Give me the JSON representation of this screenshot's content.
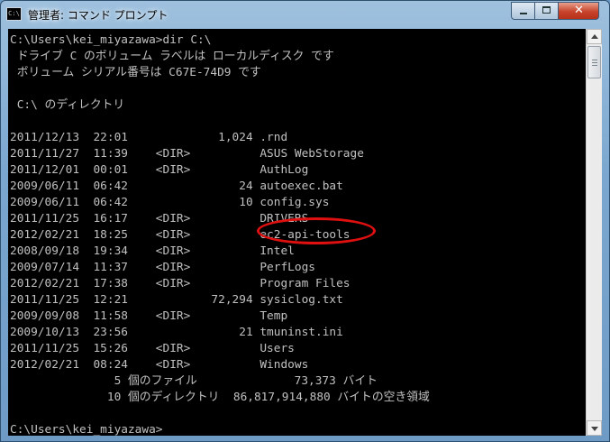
{
  "window": {
    "title": "管理者: コマンド プロンプト",
    "icon_text": "C:\\",
    "close_symbol": "✕"
  },
  "console": {
    "lines": [
      "C:\\Users\\kei_miyazawa>dir C:\\",
      " ドライブ C のボリューム ラベルは ローカルディスク です",
      " ボリューム シリアル番号は C67E-74D9 です",
      "",
      " C:\\ のディレクトリ",
      "",
      "2011/12/13  22:01             1,024 .rnd",
      "2011/11/27  11:39    <DIR>          ASUS WebStorage",
      "2011/12/01  00:01    <DIR>          AuthLog",
      "2009/06/11  06:42                24 autoexec.bat",
      "2009/06/11  06:42                10 config.sys",
      "2011/11/25  16:17    <DIR>          DRIVERS",
      "2012/02/21  18:25    <DIR>          ec2-api-tools",
      "2008/09/18  19:34    <DIR>          Intel",
      "2009/07/14  11:37    <DIR>          PerfLogs",
      "2012/02/21  17:38    <DIR>          Program Files",
      "2011/11/25  12:21            72,294 sysiclog.txt",
      "2009/09/08  11:58    <DIR>          Temp",
      "2009/10/13  23:56                21 tmuninst.ini",
      "2011/11/25  15:26    <DIR>          Users",
      "2012/02/21  08:24    <DIR>          Windows",
      "               5 個のファイル              73,373 バイト",
      "              10 個のディレクトリ  86,817,914,880 バイトの空き領域",
      "",
      "C:\\Users\\kei_miyazawa>"
    ]
  },
  "annotation": {
    "highlight_color": "#e01010"
  },
  "colors": {
    "console_background": "#000000",
    "console_text": "#c0c0c0"
  }
}
